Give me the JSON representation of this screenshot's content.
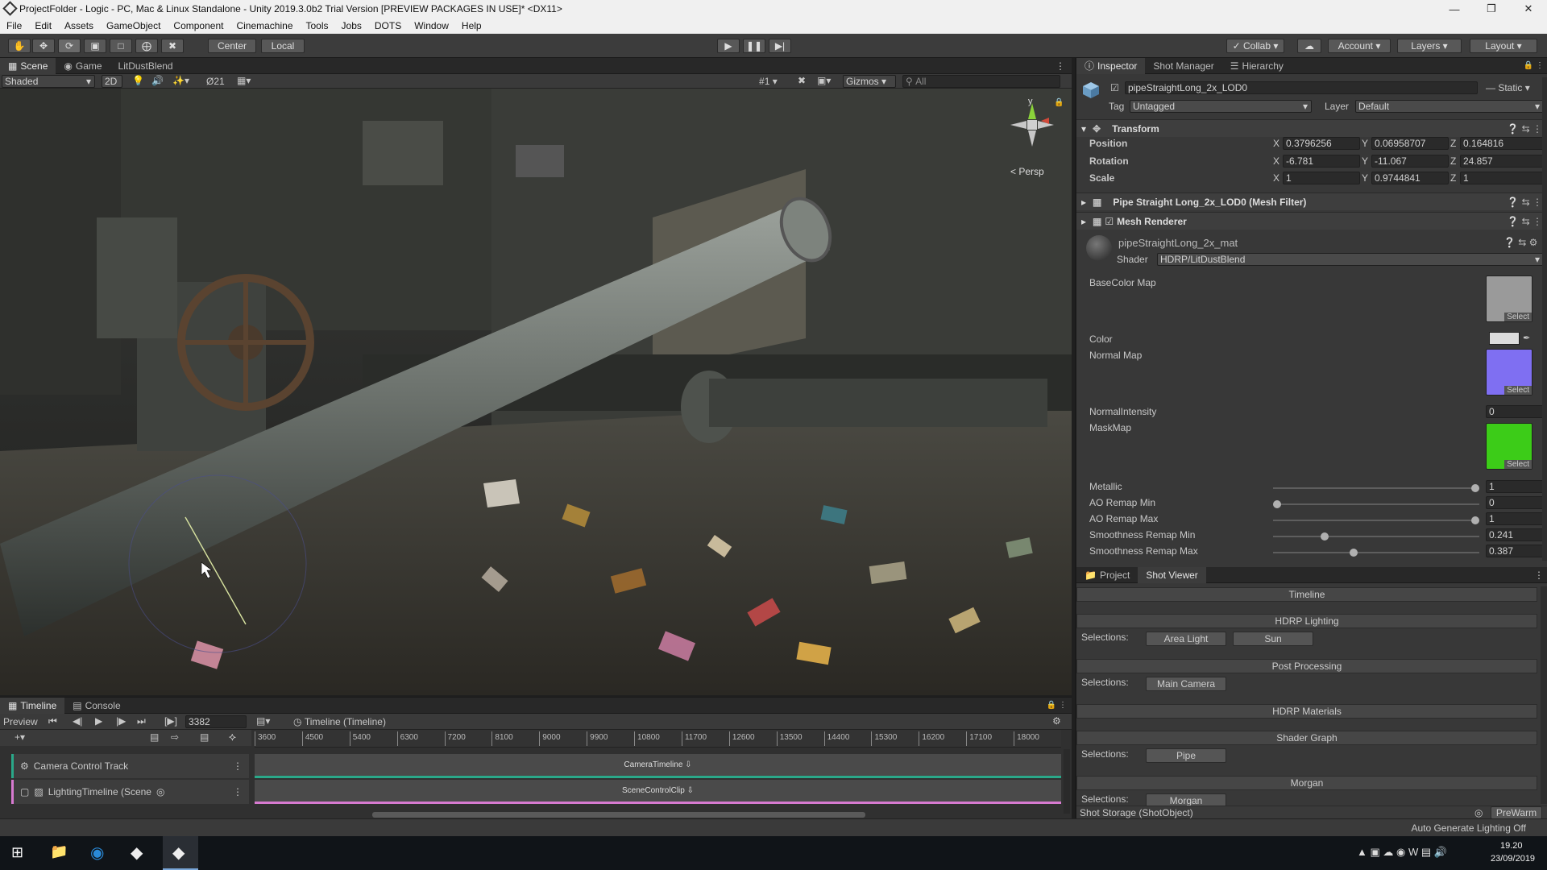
{
  "window": {
    "title": "ProjectFolder - Logic - PC, Mac & Linux Standalone - Unity 2019.3.0b2 Trial Version [PREVIEW PACKAGES IN USE]* <DX11>"
  },
  "menu": [
    "File",
    "Edit",
    "Assets",
    "GameObject",
    "Component",
    "Cinemachine",
    "Tools",
    "Jobs",
    "DOTS",
    "Window",
    "Help"
  ],
  "toolbar": {
    "center": "Center",
    "local": "Local",
    "collab": "Collab",
    "account": "Account",
    "layers": "Layers",
    "layout": "Layout"
  },
  "scene_tabs": {
    "scene": "Scene",
    "game": "Game",
    "litdust": "LitDustBlend"
  },
  "scene_bar": {
    "shading": "Shaded",
    "mode2d": "2D",
    "fx_count": "21",
    "grid_count": "1",
    "gizmos": "Gizmos",
    "search_placeholder": "All"
  },
  "gizmo": {
    "y_label": "y",
    "persp": "< Persp"
  },
  "inspector": {
    "tabs": {
      "inspector": "Inspector",
      "shot_manager": "Shot Manager",
      "hierarchy": "Hierarchy"
    },
    "object_name": "pipeStraightLong_2x_LOD0",
    "static_label": "Static",
    "tag_label": "Tag",
    "tag_value": "Untagged",
    "layer_label": "Layer",
    "layer_value": "Default",
    "transform": {
      "title": "Transform",
      "position_label": "Position",
      "px": "0.3796256",
      "py": "0.06958707",
      "pz": "0.164816",
      "rotation_label": "Rotation",
      "rx": "-6.781",
      "ry": "-11.067",
      "rz": "24.857",
      "scale_label": "Scale",
      "sx": "1",
      "sy": "0.9744841",
      "sz": "1"
    },
    "mesh_filter": "Pipe Straight Long_2x_LOD0 (Mesh Filter)",
    "mesh_renderer": "Mesh Renderer",
    "material_name": "pipeStraightLong_2x_mat",
    "shader_label": "Shader",
    "shader_value": "HDRP/LitDustBlend",
    "props": {
      "basecolor": "BaseColor Map",
      "color": "Color",
      "normal": "Normal Map",
      "normal_intensity": "NormalIntensity",
      "normal_intensity_value": "0",
      "mask": "MaskMap",
      "select": "Select",
      "metallic": "Metallic",
      "metallic_value": "1",
      "ao_min": "AO Remap Min",
      "ao_min_value": "0",
      "ao_max": "AO Remap Max",
      "ao_max_value": "1",
      "smooth_min": "Smoothness Remap Min",
      "smooth_min_value": "0.241",
      "smooth_max": "Smoothness Remap Max",
      "smooth_max_value": "0.387"
    },
    "slider_levels": {
      "metallic": 1.0,
      "ao_min": 0.0,
      "ao_max": 1.0,
      "smooth_min": 0.241,
      "smooth_max": 0.387
    }
  },
  "shot_viewer": {
    "tabs": {
      "project": "Project",
      "shot_viewer": "Shot Viewer"
    },
    "timeline": "Timeline",
    "hdrp_lighting": "HDRP Lighting",
    "selections": "Selections:",
    "area_light": "Area Light",
    "sun": "Sun",
    "post_processing": "Post Processing",
    "main_camera": "Main Camera",
    "hdrp_materials": "HDRP Materials",
    "shader_graph": "Shader Graph",
    "pipe": "Pipe",
    "morgan": "Morgan",
    "morgan_btn": "Morgan",
    "shot_storage": "Shot Storage (ShotObject)",
    "prewarm": "PreWarm"
  },
  "timeline": {
    "tabs": {
      "timeline": "Timeline",
      "console": "Console"
    },
    "preview": "Preview",
    "frame": "3382",
    "asset": "Timeline (Timeline)",
    "ruler": [
      "3600",
      "4500",
      "5400",
      "6300",
      "7200",
      "8100",
      "9000",
      "9900",
      "10800",
      "11700",
      "12600",
      "13500",
      "14400",
      "15300",
      "16200",
      "17100",
      "18000"
    ],
    "track1": "Camera Control Track",
    "track2": "LightingTimeline (Scene",
    "clip1": "CameraTimeline",
    "clip2": "SceneControlClip"
  },
  "status": {
    "lighting": "Auto Generate Lighting Off"
  },
  "taskbar": {
    "time": "19.20",
    "date": "23/09/2019"
  },
  "colors": {
    "accent_teal": "#2aa889",
    "accent_pink": "#d77ad0",
    "normal_map": "#7f6ff2",
    "mask_map": "#3ccc18"
  }
}
